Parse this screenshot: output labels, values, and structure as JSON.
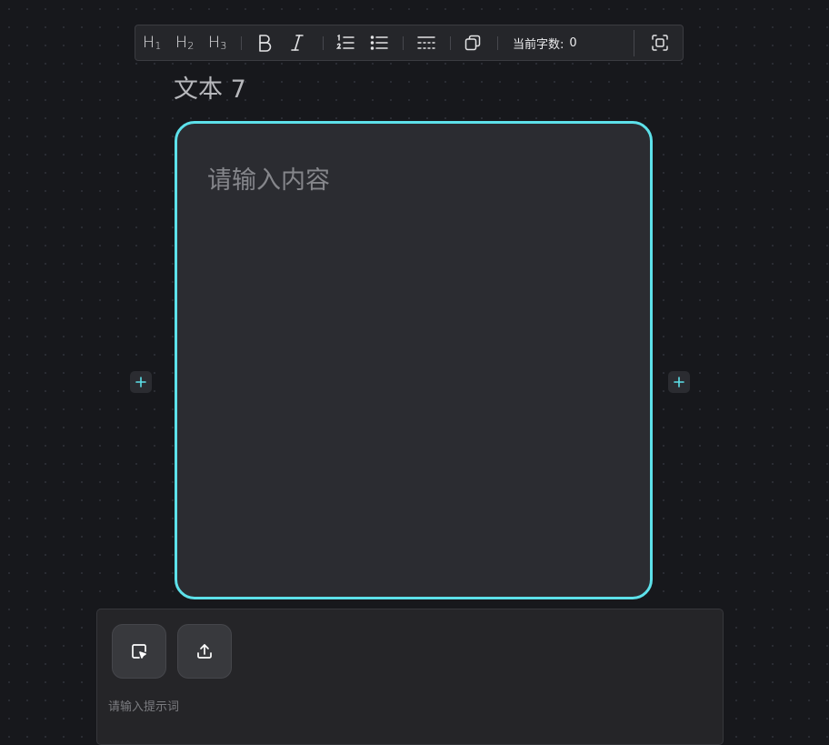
{
  "toolbar": {
    "h1": {
      "letter": "H",
      "num": "1",
      "icon": "heading-1-icon"
    },
    "h2": {
      "letter": "H",
      "num": "2",
      "icon": "heading-2-icon"
    },
    "h3": {
      "letter": "H",
      "num": "3",
      "icon": "heading-3-icon"
    },
    "bold_icon": "bold-icon",
    "italic_icon": "italic-icon",
    "ordered_list_icon": "ordered-list-icon",
    "bullet_list_icon": "bullet-list-icon",
    "divider_icon": "horizontal-rule-icon",
    "copy_icon": "copy-icon",
    "word_count_label": "当前字数:",
    "word_count_value": "0",
    "fullscreen_icon": "fullscreen-icon"
  },
  "node": {
    "title": "文本 7",
    "placeholder": "请输入内容",
    "accent_color": "#5de1ea"
  },
  "handles": {
    "left_icon": "plus-icon",
    "right_icon": "plus-icon"
  },
  "panel": {
    "select_button_icon": "select-cursor-icon",
    "upload_button_icon": "upload-icon",
    "prompt_placeholder": "请输入提示词"
  }
}
